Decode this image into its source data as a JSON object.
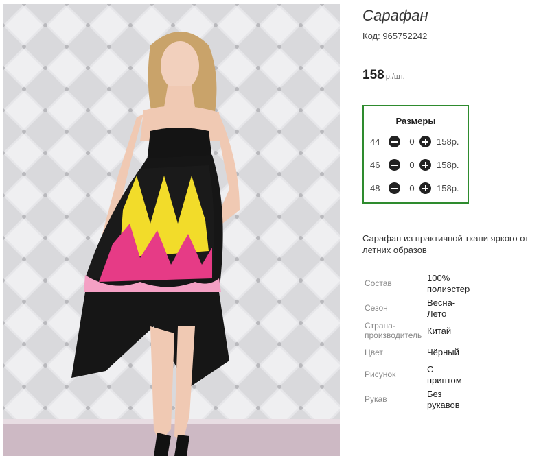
{
  "product": {
    "title": "Сарафан",
    "code": "Код: 965752242",
    "price": "158",
    "price_unit": "р./шт."
  },
  "sizes": {
    "title": "Размеры",
    "rows": [
      {
        "size": "44",
        "qty": "0",
        "price": "158р."
      },
      {
        "size": "46",
        "qty": "0",
        "price": "158р."
      },
      {
        "size": "48",
        "qty": "0",
        "price": "158р."
      }
    ],
    "border_color": "#2e8b2e"
  },
  "description": {
    "line1": "Сарафан из практичной ткани яркого от",
    "line2": "летних образов"
  },
  "specs": [
    {
      "label_lines": [
        "Состав"
      ],
      "value_lines": [
        "100%",
        "полиэстер"
      ]
    },
    {
      "label_lines": [
        "Сезон"
      ],
      "value_lines": [
        "Весна-",
        "Лето"
      ]
    },
    {
      "label_lines": [
        "Страна-",
        "производитель"
      ],
      "value_lines": [
        "Китай"
      ]
    },
    {
      "label_lines": [
        "Цвет"
      ],
      "value_lines": [
        "Чёрный"
      ]
    },
    {
      "label_lines": [
        "Рисунок"
      ],
      "value_lines": [
        "С",
        "принтом"
      ]
    },
    {
      "label_lines": [
        "Рукав"
      ],
      "value_lines": [
        "Без",
        "рукавов"
      ]
    }
  ],
  "icons": {
    "minus": "minus-circle-icon",
    "plus": "plus-circle-icon"
  }
}
